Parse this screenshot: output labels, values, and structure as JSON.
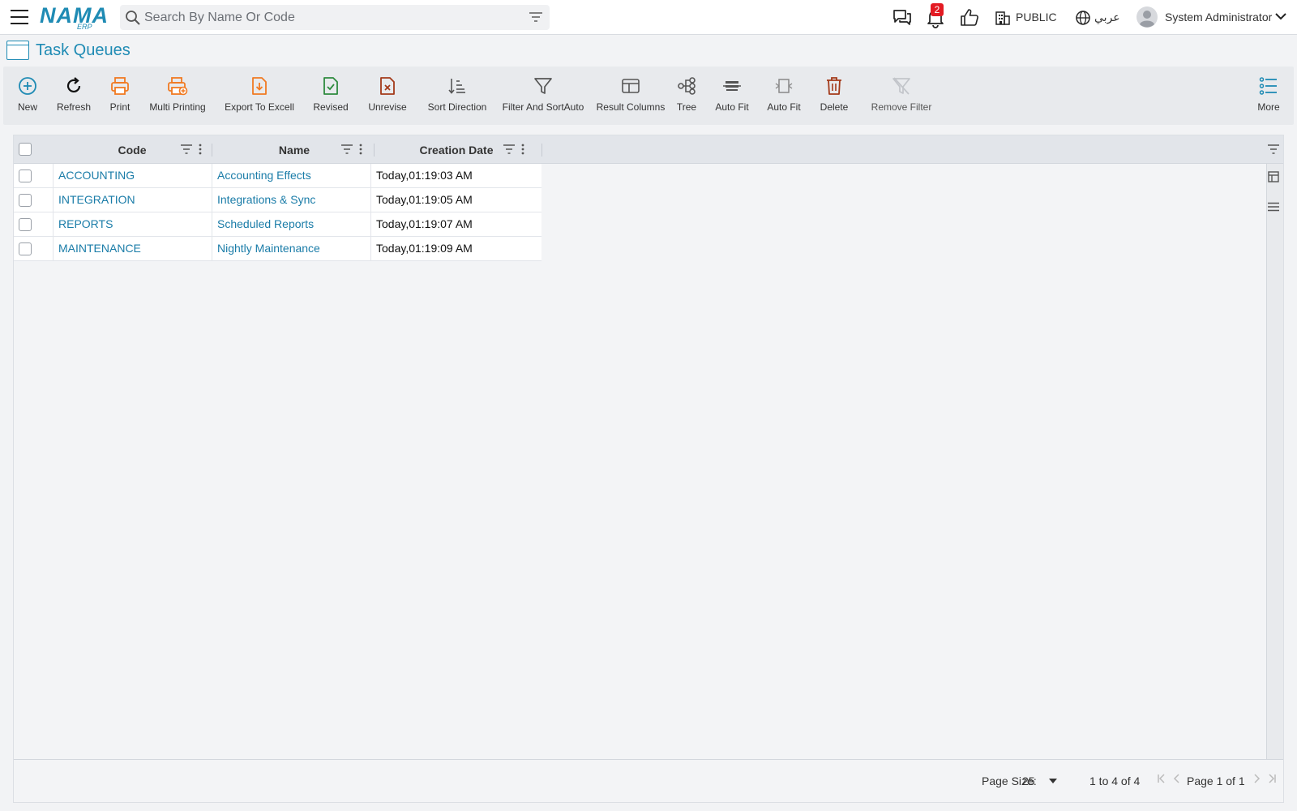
{
  "app": {
    "logo_text": "NAMA",
    "logo_sub": "ERP"
  },
  "search": {
    "placeholder": "Search By Name Or Code"
  },
  "topbar": {
    "notifications_count": "2",
    "branch": "PUBLIC",
    "language": "عربي",
    "user": "System Administrator"
  },
  "page": {
    "title": "Task Queues"
  },
  "toolbar": {
    "new": "New",
    "refresh": "Refresh",
    "print": "Print",
    "multi_printing": "Multi Printing",
    "export_excel": "Export To Excell",
    "revised": "Revised",
    "unrevise": "Unrevise",
    "sort_direction": "Sort Direction",
    "filter_sort": "Filter And SortAuto",
    "result_columns": "Result Columns",
    "tree": "Tree",
    "auto_fit_1": "Auto Fit",
    "auto_fit_2": "Auto Fit",
    "delete": "Delete",
    "remove_filter": "Remove Filter",
    "more": "More"
  },
  "grid": {
    "columns": [
      "Code",
      "Name",
      "Creation Date"
    ],
    "rows": [
      {
        "code": "ACCOUNTING",
        "name": "Accounting Effects",
        "date": "Today,01:19:03 AM"
      },
      {
        "code": "INTEGRATION",
        "name": "Integrations & Sync",
        "date": "Today,01:19:05 AM"
      },
      {
        "code": "REPORTS",
        "name": "Scheduled Reports",
        "date": "Today,01:19:07 AM"
      },
      {
        "code": "MAINTENANCE",
        "name": "Nightly Maintenance",
        "date": "Today,01:19:09 AM"
      }
    ]
  },
  "footer": {
    "page_size_label": "Page Size:",
    "page_size": "25",
    "range": "1 to 4 of 4",
    "page": "Page 1 of 1"
  },
  "colors": {
    "accent": "#1f8bb4",
    "link": "#1a7ca8",
    "orange": "#f07a22",
    "green": "#2e8b3e",
    "dark_red": "#a33a1a",
    "badge": "#e31b23"
  }
}
